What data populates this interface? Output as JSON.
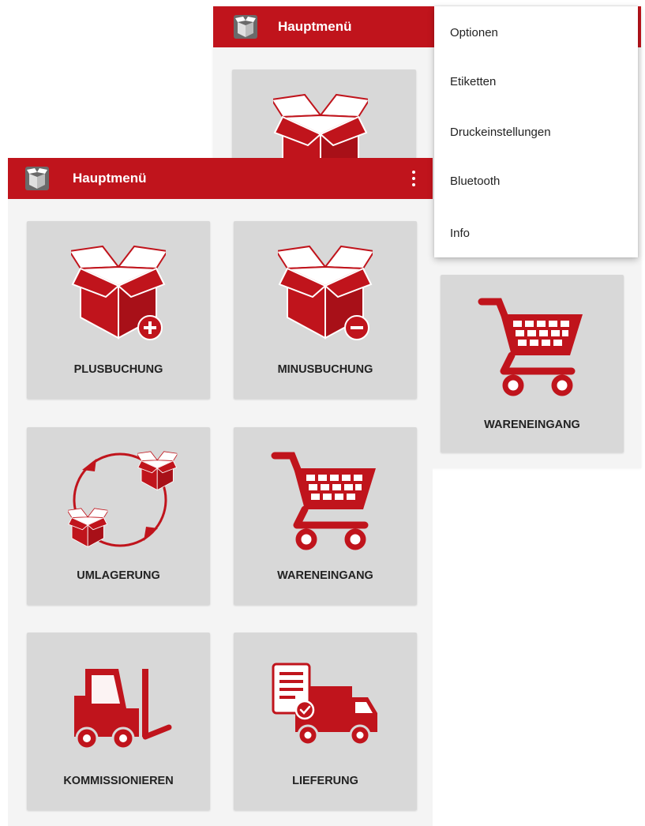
{
  "colors": {
    "accent": "#c0141c",
    "tile_bg": "#d8d8d8",
    "page_bg": "#f4f4f4"
  },
  "back_screen": {
    "appbar": {
      "title": "Hauptmenü",
      "icon": "open-box-app-icon"
    },
    "tiles": [
      {
        "label": "",
        "icon": "open-box-icon"
      },
      {
        "label": "WARENEINGANG",
        "icon": "shopping-cart-icon"
      }
    ]
  },
  "overflow_menu": {
    "items": [
      {
        "label": "Optionen"
      },
      {
        "label": "Etiketten"
      },
      {
        "label": "Druckeinstellungen"
      },
      {
        "label": "Bluetooth"
      },
      {
        "label": "Info"
      }
    ]
  },
  "front_screen": {
    "appbar": {
      "title": "Hauptmenü",
      "icon": "open-box-app-icon",
      "menu_icon": "more-vertical-icon"
    },
    "tiles": [
      {
        "label": "PLUSBUCHUNG",
        "icon": "box-plus-icon"
      },
      {
        "label": "MINUSBUCHUNG",
        "icon": "box-minus-icon"
      },
      {
        "label": "UMLAGERUNG",
        "icon": "relocation-cycle-icon"
      },
      {
        "label": "WARENEINGANG",
        "icon": "shopping-cart-icon"
      },
      {
        "label": "KOMMISSIONIEREN",
        "icon": "forklift-icon"
      },
      {
        "label": "LIEFERUNG",
        "icon": "delivery-truck-icon"
      }
    ]
  }
}
